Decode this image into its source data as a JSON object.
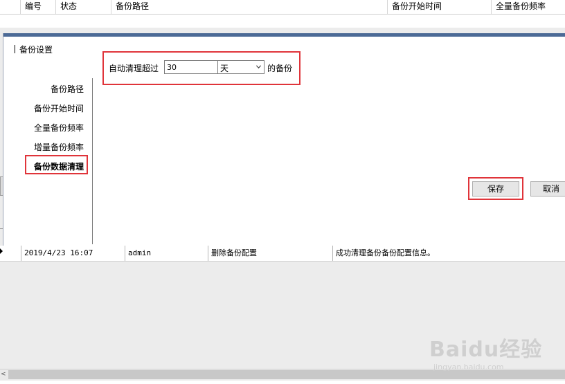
{
  "top_grid": {
    "columns": [
      "编号",
      "状态",
      "备份路径",
      "备份开始时间",
      "全量备份频率"
    ]
  },
  "dialog": {
    "title": "备份设置",
    "nav": [
      {
        "label": "备份路径",
        "selected": false
      },
      {
        "label": "备份开始时间",
        "selected": false
      },
      {
        "label": "全量备份频率",
        "selected": false
      },
      {
        "label": "增量备份频率",
        "selected": false
      },
      {
        "label": "备份数据清理",
        "selected": true
      }
    ],
    "setting": {
      "prefix": "自动清理超过",
      "days_value": "30",
      "unit": "天",
      "suffix": "的备份"
    },
    "save_label": "保存",
    "cancel_label": "取消"
  },
  "log": {
    "rows": [
      {
        "time": "2019/4/23 16:07",
        "user": "admin",
        "action": "删除备份配置",
        "message": "成功清理备份备份配置信息。"
      }
    ]
  },
  "watermark": {
    "logo": "Baidu经验",
    "url": "jingyan.baidu.com"
  },
  "colors": {
    "dialog_bar": "#4c6a96",
    "highlight": "#e0343a"
  }
}
